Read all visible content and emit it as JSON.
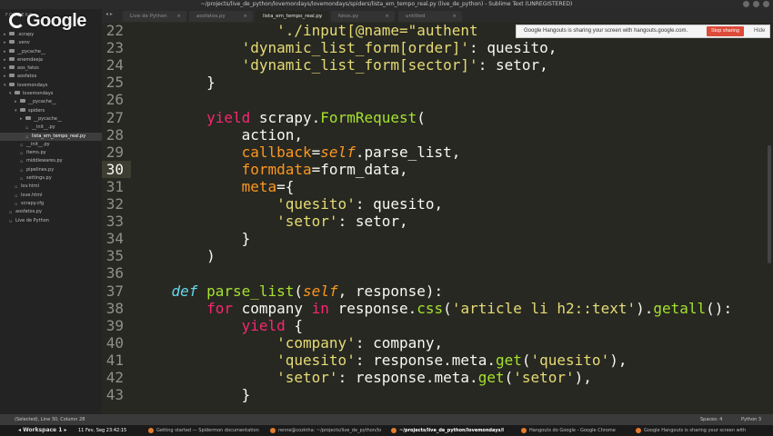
{
  "window": {
    "title": "~/projects/live_de_python/lovemondays/lovemondays/spiders/lista_em_tempo_real.py (live_de_python) - Sublime Text (UNREGISTERED)"
  },
  "sidebar": {
    "header": "FOLDERS",
    "logo": "Google",
    "items": [
      {
        "label": ".scrapy",
        "type": "folder",
        "level": 1
      },
      {
        "label": ".venv",
        "type": "folder",
        "level": 1
      },
      {
        "label": "__pycache__",
        "type": "folder",
        "level": 1
      },
      {
        "label": "enemdeeja",
        "type": "folder",
        "level": 1
      },
      {
        "label": "aos_fatos",
        "type": "folder",
        "level": 1
      },
      {
        "label": "aosfatos",
        "type": "folder",
        "level": 1
      },
      {
        "label": "lovemondays",
        "type": "folder",
        "level": 1,
        "open": true
      },
      {
        "label": "lovemondays",
        "type": "folder",
        "level": 2,
        "open": true
      },
      {
        "label": "__pycache__",
        "type": "folder",
        "level": 3
      },
      {
        "label": "spiders",
        "type": "folder",
        "level": 3,
        "open": true
      },
      {
        "label": "__pycache__",
        "type": "folder",
        "level": 4
      },
      {
        "label": "__init__.py",
        "type": "file",
        "level": 4
      },
      {
        "label": "lista_em_tempo_real.py",
        "type": "file",
        "level": 4,
        "selected": true
      },
      {
        "label": "__init__.py",
        "type": "file",
        "level": 3
      },
      {
        "label": "items.py",
        "type": "file",
        "level": 3
      },
      {
        "label": "middlewares.py",
        "type": "file",
        "level": 3
      },
      {
        "label": "pipelines.py",
        "type": "file",
        "level": 3
      },
      {
        "label": "settings.py",
        "type": "file",
        "level": 3
      },
      {
        "label": "lov.html",
        "type": "file",
        "level": 2
      },
      {
        "label": "love.html",
        "type": "file",
        "level": 2
      },
      {
        "label": "scrapy.cfg",
        "type": "file",
        "level": 2
      },
      {
        "label": "aosfatos.py",
        "type": "file",
        "level": 1
      },
      {
        "label": "Live de Python",
        "type": "file",
        "level": 1
      }
    ]
  },
  "tabs": {
    "nav": "◂ ▸",
    "items": [
      {
        "label": "Live de Python",
        "active": false
      },
      {
        "label": "aosfatos.py",
        "active": false
      },
      {
        "label": "lista_em_tempo_real.py",
        "active": true
      },
      {
        "label": "fatos.py",
        "active": false
      },
      {
        "label": "untitled",
        "active": false
      }
    ]
  },
  "editor": {
    "current_line": 30,
    "lines": [
      {
        "n": "22",
        "code": "                './input[@name=\"authent"
      },
      {
        "n": "23",
        "code": "            'dynamic_list_form[order]': quesito,"
      },
      {
        "n": "24",
        "code": "            'dynamic_list_form[sector]': setor,"
      },
      {
        "n": "25",
        "code": "        }"
      },
      {
        "n": "26",
        "code": ""
      },
      {
        "n": "27",
        "code": "        yield scrapy.FormRequest("
      },
      {
        "n": "28",
        "code": "            action,"
      },
      {
        "n": "29",
        "code": "            callback=self.parse_list,"
      },
      {
        "n": "30",
        "code": "            formdata=form_data,"
      },
      {
        "n": "31",
        "code": "            meta={"
      },
      {
        "n": "32",
        "code": "                'quesito': quesito,"
      },
      {
        "n": "33",
        "code": "                'setor': setor,"
      },
      {
        "n": "34",
        "code": "            }"
      },
      {
        "n": "35",
        "code": "        )"
      },
      {
        "n": "36",
        "code": ""
      },
      {
        "n": "37",
        "code": "    def parse_list(self, response):"
      },
      {
        "n": "38",
        "code": "        for company in response.css('article li h2::text').getall():"
      },
      {
        "n": "39",
        "code": "            yield {"
      },
      {
        "n": "40",
        "code": "                'company': company,"
      },
      {
        "n": "41",
        "code": "                'quesito': response.meta.get('quesito'),"
      },
      {
        "n": "42",
        "code": "                'setor': response.meta.get('setor'),"
      },
      {
        "n": "43",
        "code": "            }"
      }
    ]
  },
  "notification": {
    "message": "Google Hangouts is sharing your screen with hangouts.google.com.",
    "stop_label": "Stop sharing",
    "hide_label": "Hide"
  },
  "statusbar": {
    "left": "(Selected), Line 30, Column 28",
    "spaces": "Spaces: 4",
    "syntax": "Python 3"
  },
  "taskbar": {
    "workspace": "◂ Workspace 1 ▸",
    "clock": "11 Fev, Seg 23:42:15",
    "tasks": [
      {
        "label": "Getting started — Spidermon documentation",
        "active": false
      },
      {
        "label": "renne@cozinha: ~/projects/live_de_python/lo",
        "active": false
      },
      {
        "label": "~/projects/live_de_python/lovemondays/l",
        "active": true
      },
      {
        "label": "Hangouts do Google - Google Chrome",
        "active": false
      },
      {
        "label": "Google Hangouts is sharing your screen with",
        "active": false
      }
    ]
  },
  "colors": {
    "editor_bg": "#272822",
    "string": "#e6db74",
    "keyword": "#f92672",
    "builtin": "#66d9ef",
    "function": "#a6e22e",
    "argument": "#fd971f",
    "stop_button": "#dd4b39"
  }
}
